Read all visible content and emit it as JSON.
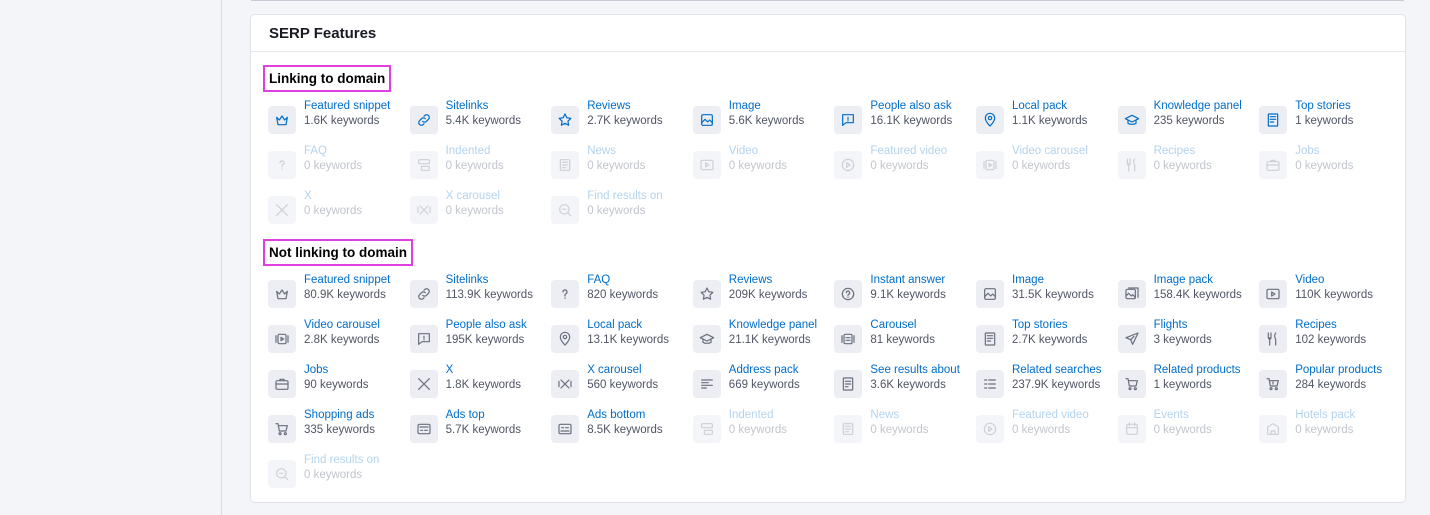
{
  "card": {
    "title": "SERP Features"
  },
  "sections": [
    {
      "title": "Linking to domain",
      "items": [
        {
          "name": "Featured snippet",
          "count": "1.6K keywords",
          "icon": "crown-icon",
          "state": "linked"
        },
        {
          "name": "Sitelinks",
          "count": "5.4K keywords",
          "icon": "link-icon",
          "state": "linked"
        },
        {
          "name": "Reviews",
          "count": "2.7K keywords",
          "icon": "star-icon",
          "state": "linked"
        },
        {
          "name": "Image",
          "count": "5.6K keywords",
          "icon": "image-icon",
          "state": "linked"
        },
        {
          "name": "People also ask",
          "count": "16.1K keywords",
          "icon": "chat-icon",
          "state": "linked"
        },
        {
          "name": "Local pack",
          "count": "1.1K keywords",
          "icon": "pin-icon",
          "state": "linked"
        },
        {
          "name": "Knowledge panel",
          "count": "235 keywords",
          "icon": "graduation-cap-icon",
          "state": "linked"
        },
        {
          "name": "Top stories",
          "count": "1 keywords",
          "icon": "news-icon",
          "state": "linked"
        },
        {
          "name": "FAQ",
          "count": "0 keywords",
          "icon": "question-icon",
          "state": "disabled"
        },
        {
          "name": "Indented",
          "count": "0 keywords",
          "icon": "indented-icon",
          "state": "disabled"
        },
        {
          "name": "News",
          "count": "0 keywords",
          "icon": "newspaper-icon",
          "state": "disabled"
        },
        {
          "name": "Video",
          "count": "0 keywords",
          "icon": "video-icon",
          "state": "disabled"
        },
        {
          "name": "Featured video",
          "count": "0 keywords",
          "icon": "play-circle-icon",
          "state": "disabled"
        },
        {
          "name": "Video carousel",
          "count": "0 keywords",
          "icon": "video-carousel-icon",
          "state": "disabled"
        },
        {
          "name": "Recipes",
          "count": "0 keywords",
          "icon": "fork-knife-icon",
          "state": "disabled"
        },
        {
          "name": "Jobs",
          "count": "0 keywords",
          "icon": "briefcase-icon",
          "state": "disabled"
        },
        {
          "name": "X",
          "count": "0 keywords",
          "icon": "x-logo-icon",
          "state": "disabled"
        },
        {
          "name": "X carousel",
          "count": "0 keywords",
          "icon": "x-carousel-icon",
          "state": "disabled"
        },
        {
          "name": "Find results on",
          "count": "0 keywords",
          "icon": "search-icon",
          "state": "disabled"
        }
      ]
    },
    {
      "title": "Not linking to domain",
      "items": [
        {
          "name": "Featured snippet",
          "count": "80.9K keywords",
          "icon": "crown-icon",
          "state": "unlinked"
        },
        {
          "name": "Sitelinks",
          "count": "113.9K keywords",
          "icon": "link-icon",
          "state": "unlinked"
        },
        {
          "name": "FAQ",
          "count": "820 keywords",
          "icon": "question-icon",
          "state": "unlinked"
        },
        {
          "name": "Reviews",
          "count": "209K keywords",
          "icon": "star-icon",
          "state": "unlinked"
        },
        {
          "name": "Instant answer",
          "count": "9.1K keywords",
          "icon": "question-circle-icon",
          "state": "unlinked"
        },
        {
          "name": "Image",
          "count": "31.5K keywords",
          "icon": "image-icon",
          "state": "unlinked"
        },
        {
          "name": "Image pack",
          "count": "158.4K keywords",
          "icon": "image-pack-icon",
          "state": "unlinked"
        },
        {
          "name": "Video",
          "count": "110K keywords",
          "icon": "video-icon",
          "state": "unlinked"
        },
        {
          "name": "Video carousel",
          "count": "2.8K keywords",
          "icon": "video-carousel-icon",
          "state": "unlinked"
        },
        {
          "name": "People also ask",
          "count": "195K keywords",
          "icon": "chat-icon",
          "state": "unlinked"
        },
        {
          "name": "Local pack",
          "count": "13.1K keywords",
          "icon": "pin-icon",
          "state": "unlinked"
        },
        {
          "name": "Knowledge panel",
          "count": "21.1K keywords",
          "icon": "graduation-cap-icon",
          "state": "unlinked"
        },
        {
          "name": "Carousel",
          "count": "81 keywords",
          "icon": "carousel-icon",
          "state": "unlinked"
        },
        {
          "name": "Top stories",
          "count": "2.7K keywords",
          "icon": "news-icon",
          "state": "unlinked"
        },
        {
          "name": "Flights",
          "count": "3 keywords",
          "icon": "plane-icon",
          "state": "unlinked"
        },
        {
          "name": "Recipes",
          "count": "102 keywords",
          "icon": "fork-knife-icon",
          "state": "unlinked"
        },
        {
          "name": "Jobs",
          "count": "90 keywords",
          "icon": "briefcase-icon",
          "state": "unlinked"
        },
        {
          "name": "X",
          "count": "1.8K keywords",
          "icon": "x-logo-icon",
          "state": "unlinked"
        },
        {
          "name": "X carousel",
          "count": "560 keywords",
          "icon": "x-carousel-icon",
          "state": "unlinked"
        },
        {
          "name": "Address pack",
          "count": "669 keywords",
          "icon": "address-icon",
          "state": "unlinked"
        },
        {
          "name": "See results about",
          "count": "3.6K keywords",
          "icon": "document-list-icon",
          "state": "unlinked"
        },
        {
          "name": "Related searches",
          "count": "237.9K keywords",
          "icon": "list-icon",
          "state": "unlinked"
        },
        {
          "name": "Related products",
          "count": "1 keywords",
          "icon": "cart-related-icon",
          "state": "unlinked"
        },
        {
          "name": "Popular products",
          "count": "284 keywords",
          "icon": "cart-popular-icon",
          "state": "unlinked"
        },
        {
          "name": "Shopping ads",
          "count": "335 keywords",
          "icon": "cart-icon",
          "state": "unlinked"
        },
        {
          "name": "Ads top",
          "count": "5.7K keywords",
          "icon": "ad-top-icon",
          "state": "unlinked"
        },
        {
          "name": "Ads bottom",
          "count": "8.5K keywords",
          "icon": "ad-bottom-icon",
          "state": "unlinked"
        },
        {
          "name": "Indented",
          "count": "0 keywords",
          "icon": "indented-icon",
          "state": "disabled"
        },
        {
          "name": "News",
          "count": "0 keywords",
          "icon": "newspaper-icon",
          "state": "disabled"
        },
        {
          "name": "Featured video",
          "count": "0 keywords",
          "icon": "play-circle-icon",
          "state": "disabled"
        },
        {
          "name": "Events",
          "count": "0 keywords",
          "icon": "calendar-icon",
          "state": "disabled"
        },
        {
          "name": "Hotels pack",
          "count": "0 keywords",
          "icon": "hotel-icon",
          "state": "disabled"
        },
        {
          "name": "Find results on",
          "count": "0 keywords",
          "icon": "search-icon",
          "state": "disabled"
        }
      ]
    }
  ],
  "colors": {
    "link_blue": "#006dca",
    "highlight_magenta": "#e03ee0",
    "muted_text": "#505565"
  }
}
